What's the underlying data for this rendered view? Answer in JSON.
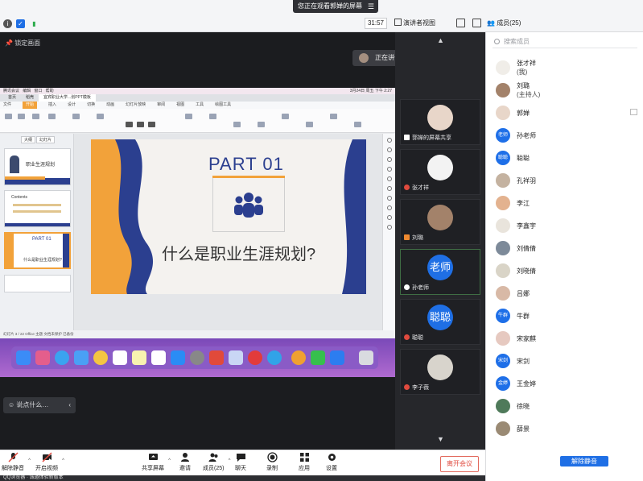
{
  "banner": {
    "text": "您正在观看郭婵的屏幕"
  },
  "topbar": {
    "timer": "31:57",
    "view_mode": "演讲者视图",
    "members_title": "成员(25)"
  },
  "stage": {
    "lock_label": "锁定画面",
    "chat_placeholder": "说点什么…"
  },
  "speaking": {
    "label": "正在讲话: 孙老师;"
  },
  "shared_screen": {
    "mac_menu": [
      "腾讯会议",
      "编辑",
      "窗口",
      "帮助"
    ],
    "mac_clock": "3月24日 周五 下午 2:27",
    "wps_tabs": [
      "首页",
      "稻壳",
      "宜宾职业大学...划PPT模板"
    ],
    "ribbon_tabs": [
      "文件",
      "开始",
      "插入",
      "设计",
      "切换",
      "动画",
      "幻灯片放映",
      "审阅",
      "视图",
      "工具",
      "绘图工具"
    ],
    "thumb_tabs": [
      "大纲",
      "幻灯片"
    ],
    "thumb1_title": "职业生涯规划",
    "thumb2_title": "Contents",
    "thumb3_part": "PART 01",
    "thumb3_title": "什么是职业生涯规划?",
    "slide_part": "PART 01",
    "slide_title": "什么是职业生涯规划?",
    "status": "幻灯片 3 / 22    Office 主题    文档未保护    已备份"
  },
  "video_tiles": [
    {
      "name": "郭婵的屏幕共享",
      "avatar": ""
    },
    {
      "name": "张才祥",
      "avatar": ""
    },
    {
      "name": "刘璐",
      "avatar": ""
    },
    {
      "name": "孙老师",
      "avatar": "老师"
    },
    {
      "name": "聪聪",
      "avatar": "聪聪"
    },
    {
      "name": "李子薇",
      "avatar": ""
    }
  ],
  "panel": {
    "search_placeholder": "搜索成员",
    "members": [
      {
        "name": "张才祥",
        "sub": "(我)",
        "avatar": ""
      },
      {
        "name": "刘璐",
        "sub": "(主持人)",
        "avatar": ""
      },
      {
        "name": "郭婵",
        "sub": "",
        "avatar": ""
      },
      {
        "name": "孙老师",
        "sub": "",
        "avatar": "老师"
      },
      {
        "name": "聪聪",
        "sub": "",
        "avatar": "聪聪"
      },
      {
        "name": "孔祥羽",
        "sub": "",
        "avatar": ""
      },
      {
        "name": "李江",
        "sub": "",
        "avatar": ""
      },
      {
        "name": "李鑫宇",
        "sub": "",
        "avatar": ""
      },
      {
        "name": "刘倩倩",
        "sub": "",
        "avatar": ""
      },
      {
        "name": "刘晓倩",
        "sub": "",
        "avatar": ""
      },
      {
        "name": "吕娜",
        "sub": "",
        "avatar": ""
      },
      {
        "name": "牛群",
        "sub": "",
        "avatar": "牛群"
      },
      {
        "name": "宋家麒",
        "sub": "",
        "avatar": ""
      },
      {
        "name": "宋剑",
        "sub": "",
        "avatar": "宋剑"
      },
      {
        "name": "王金婷",
        "sub": "",
        "avatar": "金婷"
      },
      {
        "name": "徐晓",
        "sub": "",
        "avatar": ""
      },
      {
        "name": "薛景",
        "sub": "",
        "avatar": ""
      }
    ],
    "mute_all_label": "解除静音"
  },
  "toolbar": {
    "unmute": "解除静音",
    "start_video": "开启视频",
    "share_screen": "共享屏幕",
    "invite": "邀请",
    "members": "成员(25)",
    "chat": "聊天",
    "record": "录制",
    "apps": "应用",
    "settings": "设置",
    "leave": "离开会议"
  },
  "footer": {
    "text": "QQ浏览器 · 诚邀体验新版本"
  },
  "colors": {
    "accent": "#1f6fe5",
    "danger": "#e04a3e",
    "slide_orange": "#f2a23a",
    "slide_navy": "#2b3f8f"
  }
}
